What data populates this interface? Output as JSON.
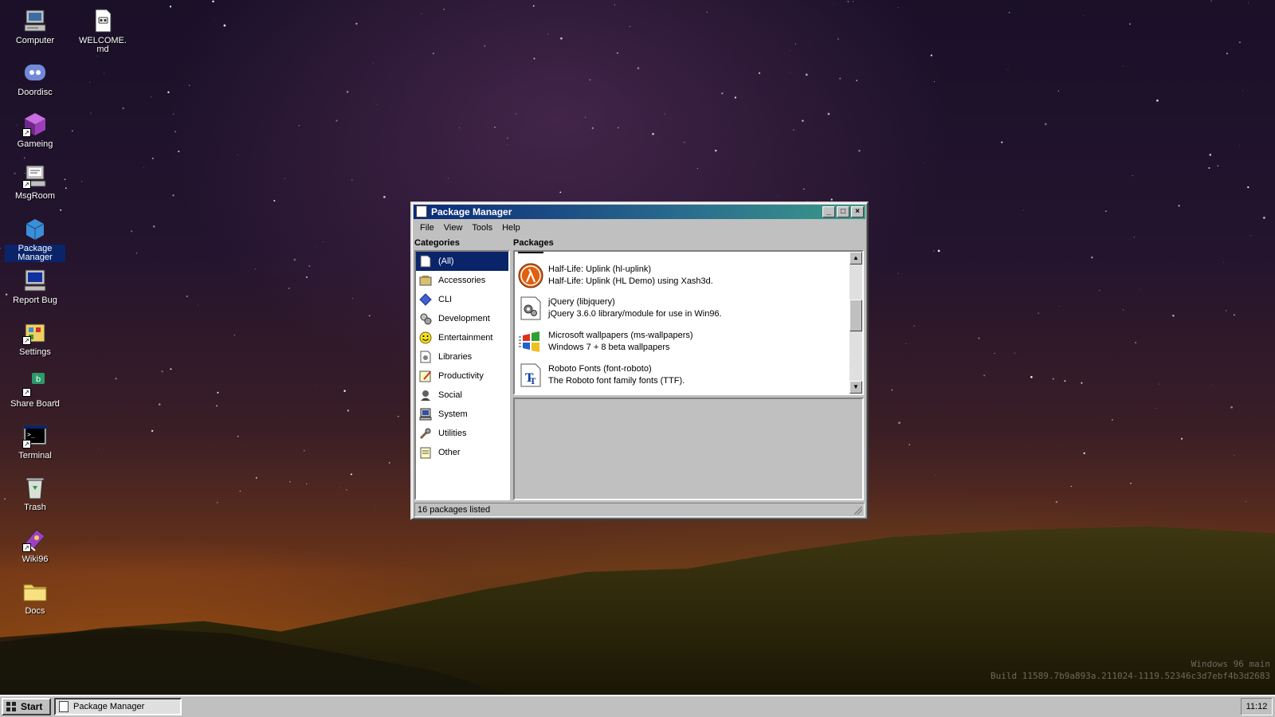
{
  "desktop": {
    "icons": [
      {
        "label": "Computer",
        "icon": "computer-icon"
      },
      {
        "label": "WELCOME.md",
        "icon": "document-icon"
      },
      {
        "label": "Doordisc",
        "icon": "discord-icon"
      },
      {
        "label": "Gameing",
        "icon": "cube-icon"
      },
      {
        "label": "MsgRoom",
        "icon": "chat-icon"
      },
      {
        "label": "Package Manager",
        "icon": "package-icon"
      },
      {
        "label": "Report Bug",
        "icon": "bug-report-icon"
      },
      {
        "label": "Settings",
        "icon": "settings-icon"
      },
      {
        "label": "Share Board",
        "icon": "share-board-icon"
      },
      {
        "label": "Terminal",
        "icon": "terminal-icon"
      },
      {
        "label": "Trash",
        "icon": "trash-icon"
      },
      {
        "label": "Wiki96",
        "icon": "wiki-book-icon"
      },
      {
        "label": "Docs",
        "icon": "folder-icon"
      }
    ],
    "build_line1": "Windows 96 main",
    "build_line2": "Build 11589.7b9a893a.211024-1119.52346c3d7ebf4b3d2683"
  },
  "window": {
    "title": "Package Manager",
    "menu": [
      "File",
      "View",
      "Tools",
      "Help"
    ],
    "categories_label": "Categories",
    "packages_label": "Packages",
    "categories": [
      {
        "label": "(All)",
        "icon": "all-icon",
        "selected": true
      },
      {
        "label": "Accessories",
        "icon": "accessories-icon"
      },
      {
        "label": "CLI",
        "icon": "cli-icon"
      },
      {
        "label": "Development",
        "icon": "development-icon"
      },
      {
        "label": "Entertainment",
        "icon": "entertainment-icon"
      },
      {
        "label": "Libraries",
        "icon": "libraries-icon"
      },
      {
        "label": "Productivity",
        "icon": "productivity-icon"
      },
      {
        "label": "Social",
        "icon": "social-icon"
      },
      {
        "label": "System",
        "icon": "system-icon"
      },
      {
        "label": "Utilities",
        "icon": "utilities-icon"
      },
      {
        "label": "Other",
        "icon": "other-icon"
      }
    ],
    "packages": [
      {
        "name": "Half-Life: Uplink (hl-uplink)",
        "desc": "Half-Life: Uplink (HL Demo) using Xash3d.",
        "icon": "half-life-icon"
      },
      {
        "name": "jQuery (libjquery)",
        "desc": "jQuery 3.6.0 library/module for use in Win96.",
        "icon": "library-gear-icon"
      },
      {
        "name": "Microsoft wallpapers (ms-wallpapers)",
        "desc": "Windows 7 + 8 beta wallpapers",
        "icon": "windows-logo-icon"
      },
      {
        "name": "Roboto Fonts (font-roboto)",
        "desc": "The Roboto font family fonts (TTF).",
        "icon": "font-icon"
      }
    ],
    "status": "16 packages listed"
  },
  "taskbar": {
    "start_label": "Start",
    "task_label": "Package Manager",
    "clock": "11:12"
  }
}
